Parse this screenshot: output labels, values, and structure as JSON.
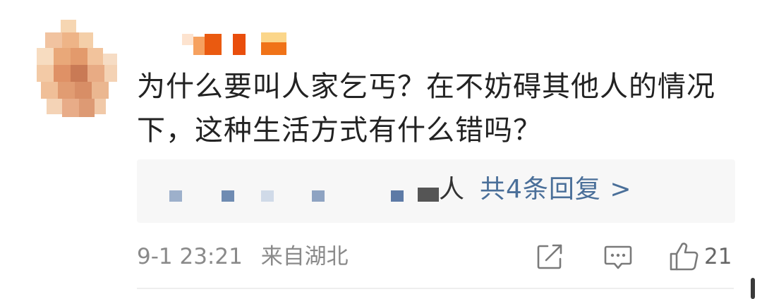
{
  "comment": {
    "text": "为什么要叫人家乞丐？在不妨碍其他人的情况下，这种生活方式有什么错吗？"
  },
  "replies": {
    "name_suffix": "人",
    "link_label": "共4条回复 >"
  },
  "meta": {
    "date": "9-1 23:21",
    "location": "来自湖北"
  },
  "actions": {
    "share_icon": "share-icon",
    "comment_icon": "comment-icon",
    "like_icon": "thumbs-up-icon",
    "like_count": "21"
  },
  "colors": {
    "text": "#222222",
    "link": "#4a6f99",
    "meta": "#8a8a8a",
    "reply_bg": "#f7f7f7"
  }
}
